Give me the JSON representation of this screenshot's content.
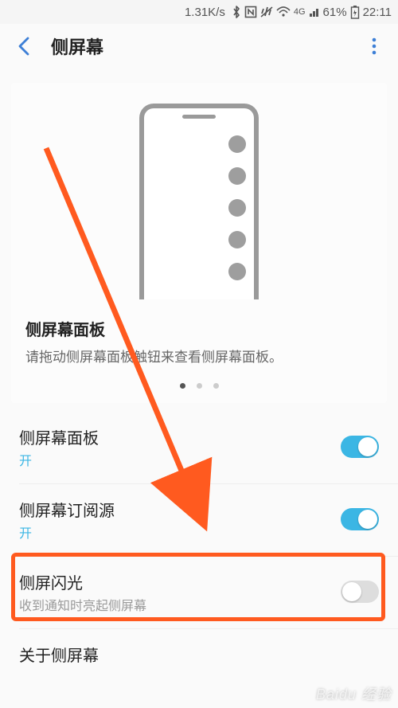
{
  "status": {
    "speed": "1.31K/s",
    "battery": "61%",
    "time": "22:11"
  },
  "header": {
    "title": "侧屏幕"
  },
  "preview": {
    "title": "侧屏幕面板",
    "desc": "请拖动侧屏幕面板触钮来查看侧屏幕面板。",
    "page_count": 3,
    "active_page": 0
  },
  "rows": [
    {
      "title": "侧屏幕面板",
      "sub": "开",
      "sub_style": "blue",
      "switch": "on"
    },
    {
      "title": "侧屏幕订阅源",
      "sub": "开",
      "sub_style": "blue",
      "switch": "on"
    },
    {
      "title": "侧屏闪光",
      "sub": "收到通知时亮起侧屏幕",
      "sub_style": "grey",
      "switch": "off"
    },
    {
      "title": "关于侧屏幕",
      "sub": null,
      "switch": null
    }
  ],
  "annotation": {
    "arrow_color": "#ff5a1f",
    "highlight_index": 2
  },
  "watermark": {
    "brand": "Baidu 经验"
  }
}
